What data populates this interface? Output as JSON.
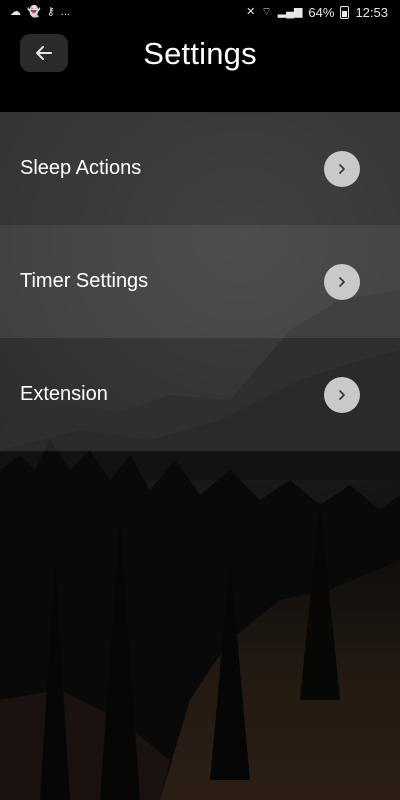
{
  "status_bar": {
    "left_icons": [
      "cloud-icon",
      "snapchat-icon",
      "key-icon"
    ],
    "left_more": "...",
    "battery": "64%",
    "time": "12:53",
    "right_icons": [
      "mute-icon",
      "wifi-icon",
      "signal-icon",
      "battery-icon"
    ]
  },
  "header": {
    "title": "Settings",
    "back_icon": "arrow-left-icon"
  },
  "menu": {
    "items": [
      {
        "label": "Sleep Actions",
        "icon": "chevron-right-icon"
      },
      {
        "label": "Timer Settings",
        "icon": "chevron-right-icon"
      },
      {
        "label": "Extension",
        "icon": "chevron-right-icon"
      }
    ]
  },
  "colors": {
    "header_bg": "#000000",
    "chevron_button_bg": "#c9c9c9",
    "text": "#ffffff"
  }
}
